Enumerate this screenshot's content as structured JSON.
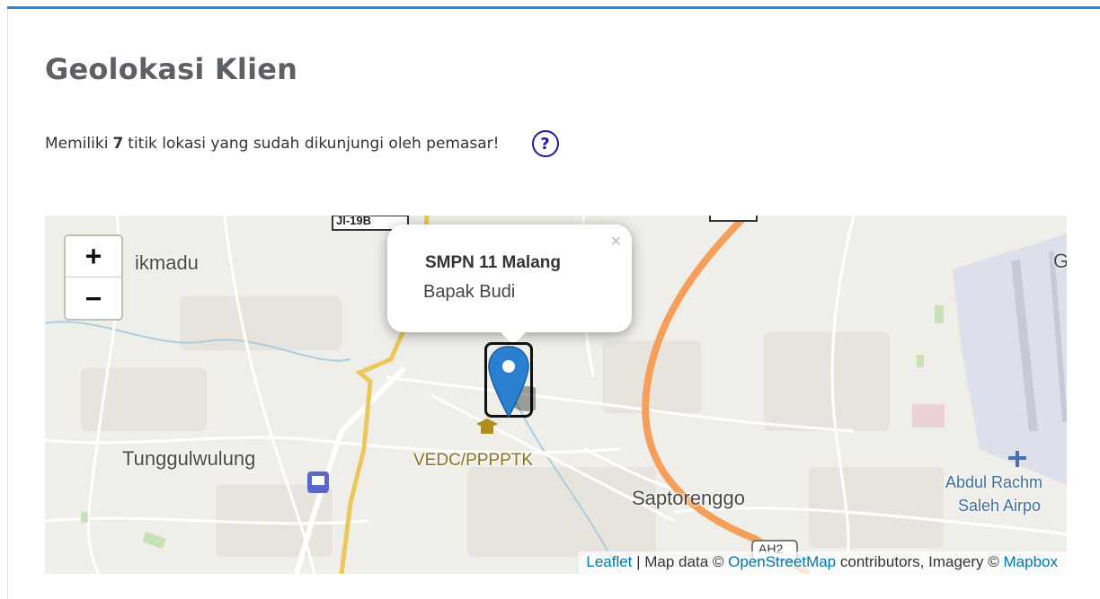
{
  "page": {
    "title": "Geolokasi Klien",
    "subtitle_prefix": "Memiliki",
    "subtitle_count": "7",
    "subtitle_suffix": "titik lokasi yang sudah dikunjungi oleh pemasar!",
    "help_icon": "question-circle-icon",
    "help_label": "?"
  },
  "map": {
    "zoom_in_label": "+",
    "zoom_out_label": "−",
    "road_labels": [
      "Jl-19B"
    ],
    "place_labels": {
      "sikmadu": "ikmadu",
      "tunggulwulung": "Tunggulwulung",
      "vedc": "VEDC/PPPPTK",
      "saptorenggo": "Saptorenggo",
      "airport_line1": "Abdul Rachm",
      "airport_line2": "Saleh Airpo",
      "edge_letter": "G",
      "road_badge": "AH2"
    },
    "popup": {
      "title": "SMPN 11 Malang",
      "subtitle": "Bapak Budi",
      "close_label": "×"
    },
    "marker_icon": "map-pin-icon",
    "attribution": {
      "leaflet": "Leaflet",
      "sep": " | Map data © ",
      "osm": "OpenStreetMap",
      "middle": " contributors, Imagery © ",
      "mapbox": "Mapbox"
    }
  }
}
